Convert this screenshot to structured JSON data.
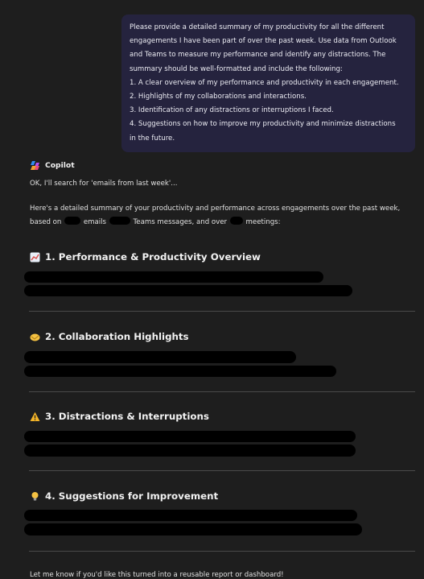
{
  "user_message": {
    "lines": [
      "Please provide a detailed summary of my productivity for all the different",
      "engagements I have been part of over the past week. Use data from Outlook",
      "and Teams to measure my performance and identify any distractions. The",
      "summary should be well-formatted and include the following:",
      "1. A clear overview of my performance and productivity in each engagement.",
      "2. Highlights of my collaborations and interactions.",
      "3. Identification of any distractions or interruptions I faced.",
      "4. Suggestions on how to improve my productivity and minimize distractions",
      "in the future."
    ]
  },
  "assistant": {
    "name": "Copilot",
    "status": "OK, I'll search for 'emails from last week'...",
    "intro_line1": "Here's a detailed summary of your productivity and performance across engagements over the past week,",
    "intro_based_on": "based on",
    "intro_emails": "emails",
    "intro_teams": "Teams messages, and over",
    "intro_meetings": "meetings:"
  },
  "sections": [
    {
      "title": "1. Performance & Productivity Overview",
      "icon": "chart-icon"
    },
    {
      "title": "2. Collaboration Highlights",
      "icon": "handshake-icon"
    },
    {
      "title": "3. Distractions & Interruptions",
      "icon": "warning-icon"
    },
    {
      "title": "4. Suggestions for Improvement",
      "icon": "lightbulb-icon"
    }
  ],
  "footer": "Let me know if you'd like this turned into a reusable report or dashboard!"
}
